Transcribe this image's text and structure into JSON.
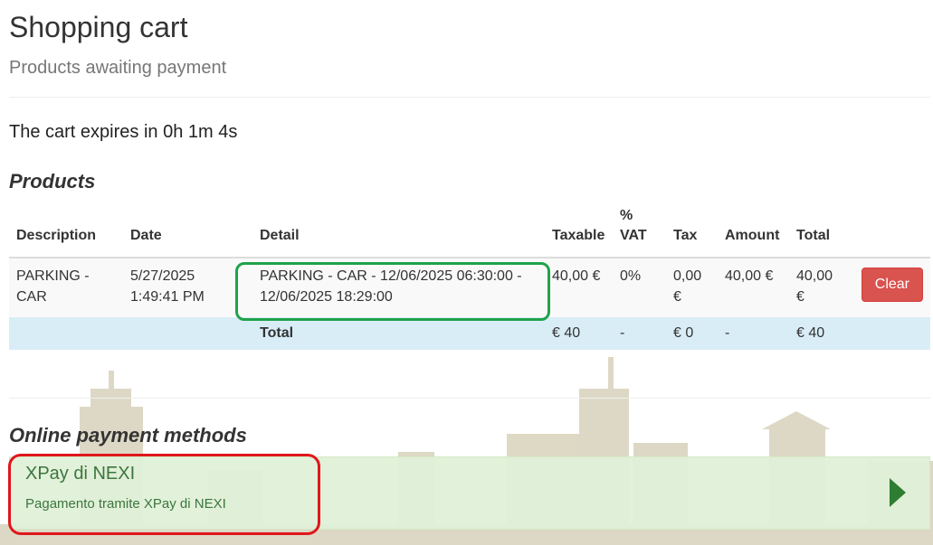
{
  "header": {
    "title": "Shopping cart",
    "subtitle": "Products awaiting payment"
  },
  "cart": {
    "expires_text": "The cart expires in 0h 1m 4s"
  },
  "products": {
    "section_title": "Products",
    "columns": {
      "description": "Description",
      "date": "Date",
      "detail": "Detail",
      "taxable": "Taxable",
      "vat_symbol": "%",
      "vat": "VAT",
      "tax": "Tax",
      "amount": "Amount",
      "total": "Total"
    },
    "rows": [
      {
        "description_line1": "PARKING -",
        "description_line2": "CAR",
        "date_line1": "5/27/2025",
        "date_line2": "1:49:41 PM",
        "detail_line1": "PARKING - CAR - 12/06/2025 06:30:00 -",
        "detail_line2": "12/06/2025 18:29:00",
        "taxable": "40,00 €",
        "vat": "0%",
        "tax_line1": "0,00",
        "tax_line2": "€",
        "amount": "40,00 €",
        "total_line1": "40,00",
        "total_line2": "€",
        "clear_label": "Clear"
      }
    ],
    "totals": {
      "label": "Total",
      "taxable": "€ 40",
      "vat": "-",
      "tax": "€ 0",
      "amount": "-",
      "total": "€ 40"
    }
  },
  "payment": {
    "section_title": "Online payment methods",
    "methods": [
      {
        "name": "XPay di NEXI",
        "description": "Pagamento tramite XPay di NEXI"
      }
    ]
  },
  "colors": {
    "clear_button": "#d9534f",
    "total_row": "#d9edf7",
    "payment_bg": "#dff0d8",
    "payment_text": "#3c763d",
    "highlight_green": "#1fa34a",
    "highlight_red": "#e0161c",
    "skyline": "#c9c2a6"
  },
  "icons": {
    "payment_arrow": "play-arrow-icon"
  }
}
